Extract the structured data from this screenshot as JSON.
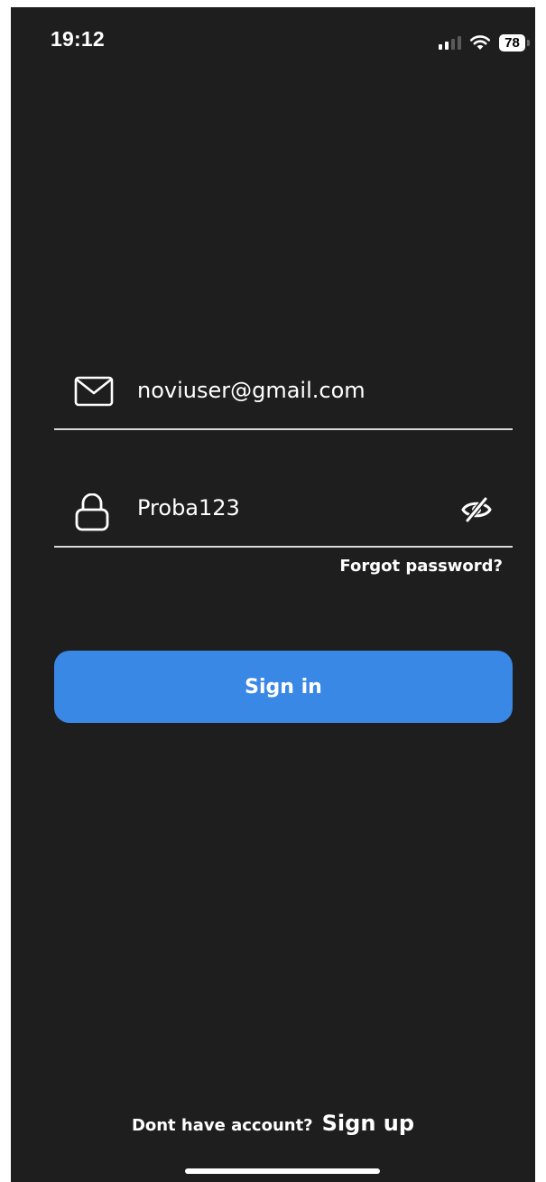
{
  "status_bar": {
    "time": "19:12",
    "battery_level": "78",
    "signal_bars_active": 2,
    "signal_bars_total": 4
  },
  "form": {
    "email": {
      "value": "noviuser@gmail.com",
      "icon": "mail-icon"
    },
    "password": {
      "value": "Proba123",
      "icon": "lock-icon",
      "toggle_icon": "eye-slash-icon"
    },
    "forgot_password_label": "Forgot password?",
    "sign_in_label": "Sign in"
  },
  "footer": {
    "prompt": "Dont have account?",
    "sign_up_label": "Sign up"
  },
  "colors": {
    "background": "#1e1e1e",
    "primary_button": "#3a88e5",
    "text": "#ffffff",
    "divider": "#d8d8d8"
  }
}
